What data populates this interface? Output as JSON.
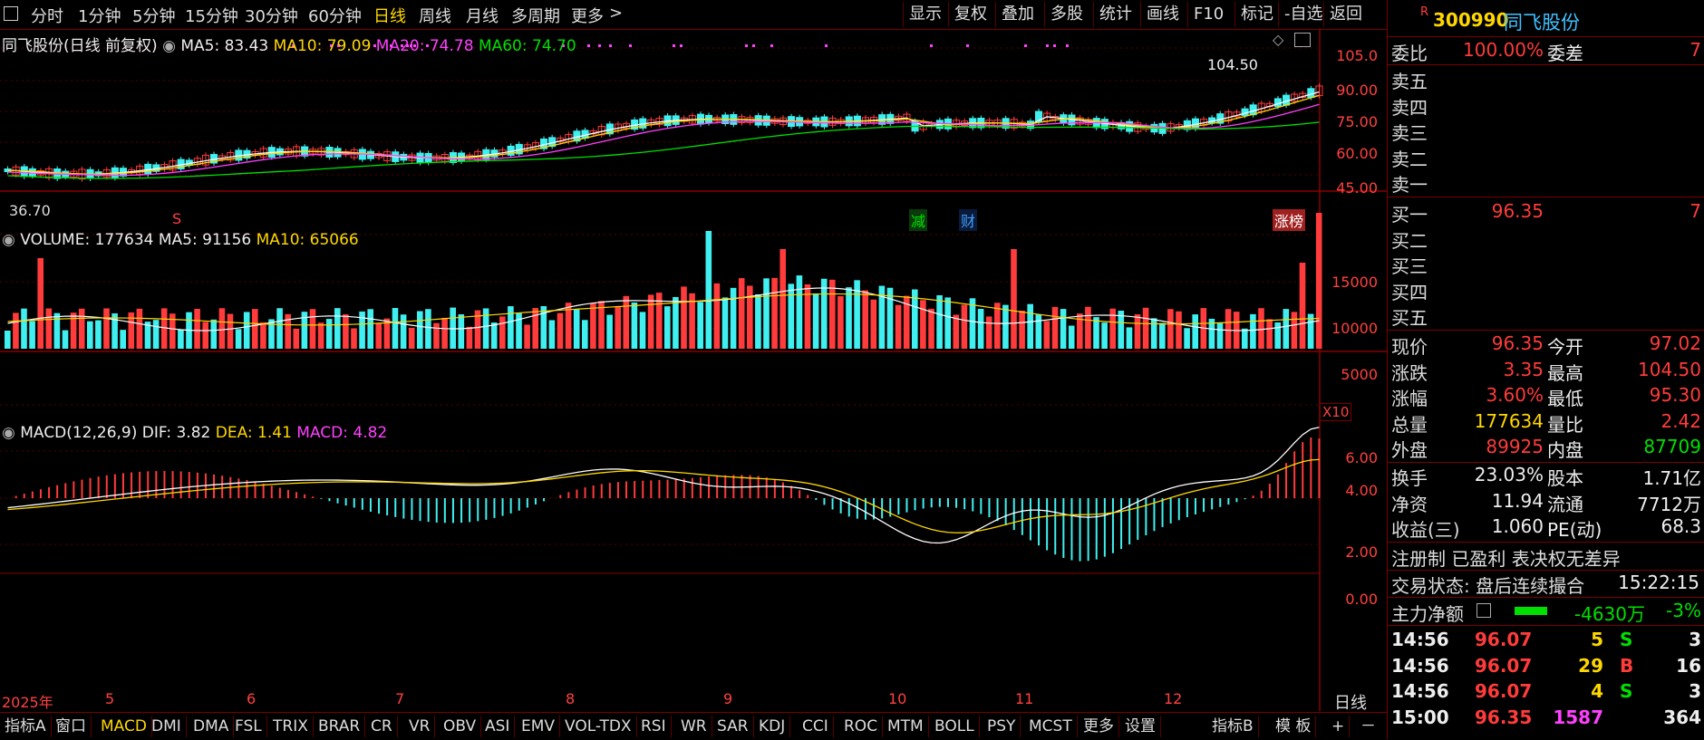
{
  "toolbar": {
    "periods": [
      "分时",
      "1分钟",
      "5分钟",
      "15分钟",
      "30分钟",
      "60分钟",
      "日线",
      "周线",
      "月线",
      "多周期",
      "更多"
    ],
    "active_period": "日线",
    "buttons": [
      "显示",
      "复权",
      "叠加",
      "多股",
      "统计",
      "画线",
      "F10",
      "标记",
      "-自选",
      "返回"
    ]
  },
  "price_panel": {
    "title": "同飞股份(日线 前复权)",
    "ma5": "MA5: 83.43",
    "ma10": "MA10: 79.09",
    "ma20": "MA20: 74.78",
    "ma60": "MA60: 74.70",
    "y_ticks": [
      "105.0",
      "90.00",
      "75.00",
      "60.00",
      "45.00"
    ],
    "high_label": "104.50",
    "low_label": "36.70",
    "markers": {
      "s": "S",
      "jian": "减",
      "cai": "财",
      "zhangbang": "涨榜"
    }
  },
  "volume_panel": {
    "title": "VOLUME: 177634",
    "ma5": "MA5: 91156",
    "ma10": "MA10: 65066",
    "y_ticks": [
      "15000",
      "10000",
      "5000"
    ],
    "unit": "X10"
  },
  "macd_panel": {
    "title": "MACD(12,26,9)",
    "dif": "DIF: 3.82",
    "dea": "DEA: 1.41",
    "macd": "MACD: 4.82",
    "y_ticks": [
      "6.00",
      "4.00",
      "2.00",
      "0.00"
    ]
  },
  "months": [
    "2025年",
    "5",
    "6",
    "7",
    "8",
    "9",
    "10",
    "11",
    "12"
  ],
  "period_label": "日线",
  "bottom_tabs": [
    "指标A",
    "窗口",
    "MACD",
    "DMI",
    "DMA",
    "FSL",
    "TRIX",
    "BRAR",
    "CR",
    "VR",
    "OBV",
    "ASI",
    "EMV",
    "VOL-TDX",
    "RSI",
    "WR",
    "SAR",
    "KDJ",
    "CCI",
    "ROC",
    "MTM",
    "BOLL",
    "PSY",
    "MCST",
    "更多",
    "设置"
  ],
  "active_tab": "MACD",
  "bottom_right": {
    "b": "指标B",
    "mb": "模 板",
    "plus": "+",
    "minus": "－"
  },
  "stock": {
    "badge": "R",
    "code": "300990",
    "name": "同飞股份"
  },
  "weibi": {
    "label1": "委比",
    "val1": "100.00%",
    "label2": "委差",
    "val2": "7"
  },
  "asks": [
    "卖五",
    "卖四",
    "卖三",
    "卖二",
    "卖一"
  ],
  "bids": [
    {
      "label": "买一",
      "price": "96.35",
      "vol": "7"
    },
    {
      "label": "买二",
      "price": "",
      "vol": ""
    },
    {
      "label": "买三",
      "price": "",
      "vol": ""
    },
    {
      "label": "买四",
      "price": "",
      "vol": ""
    },
    {
      "label": "买五",
      "price": "",
      "vol": ""
    }
  ],
  "quote": [
    {
      "l1": "现价",
      "v1": "96.35",
      "c1": "red",
      "l2": "今开",
      "v2": "97.02",
      "c2": "red"
    },
    {
      "l1": "涨跌",
      "v1": "3.35",
      "c1": "red",
      "l2": "最高",
      "v2": "104.50",
      "c2": "red"
    },
    {
      "l1": "涨幅",
      "v1": "3.60%",
      "c1": "red",
      "l2": "最低",
      "v2": "95.30",
      "c2": "red"
    },
    {
      "l1": "总量",
      "v1": "177634",
      "c1": "yel",
      "l2": "量比",
      "v2": "2.42",
      "c2": "red"
    },
    {
      "l1": "外盘",
      "v1": "89925",
      "c1": "red",
      "l2": "内盘",
      "v2": "87709",
      "c2": "grn"
    }
  ],
  "fund": [
    {
      "l1": "换手",
      "v1": "23.03%",
      "l2": "股本",
      "v2": "1.71亿"
    },
    {
      "l1": "净资",
      "v1": "11.94",
      "l2": "流通",
      "v2": "7712万"
    },
    {
      "l1": "收益(三)",
      "v1": "1.060",
      "l2": "PE(动)",
      "v2": "68.3"
    }
  ],
  "tags": "注册制 已盈利 表决权无差异",
  "trade_status": {
    "label": "交易状态: 盘后连续撮合",
    "time": "15:22:15"
  },
  "main_flow": {
    "label": "主力净额",
    "val": "-4630万",
    "pct": "-3%"
  },
  "ticks": [
    {
      "t": "14:56",
      "p": "96.07",
      "v": "5",
      "vc": "yel",
      "d": "S",
      "dc": "grn",
      "n": "3"
    },
    {
      "t": "14:56",
      "p": "96.07",
      "v": "29",
      "vc": "yel",
      "d": "B",
      "dc": "red",
      "n": "16"
    },
    {
      "t": "14:56",
      "p": "96.07",
      "v": "4",
      "vc": "yel",
      "d": "S",
      "dc": "grn",
      "n": "3"
    },
    {
      "t": "15:00",
      "p": "96.35",
      "v": "1587",
      "vc": "mag",
      "d": "",
      "dc": "",
      "n": "364"
    }
  ]
}
